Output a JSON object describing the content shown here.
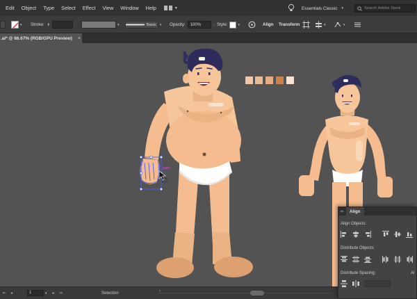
{
  "menu": {
    "items": [
      {
        "name": "menu-edit",
        "label": "Edit"
      },
      {
        "name": "menu-object",
        "label": "Object"
      },
      {
        "name": "menu-type",
        "label": "Type"
      },
      {
        "name": "menu-select",
        "label": "Select"
      },
      {
        "name": "menu-effect",
        "label": "Effect"
      },
      {
        "name": "menu-view",
        "label": "View"
      },
      {
        "name": "menu-window",
        "label": "Window"
      },
      {
        "name": "menu-help",
        "label": "Help"
      }
    ],
    "workspace": "Essentials Classic",
    "search_placeholder": "Search Adobe Stock"
  },
  "control": {
    "stroke_label": "Stroke:",
    "brush_label": "Basic",
    "opacity_label": "Opacity:",
    "opacity_value": "100%",
    "style_label": "Style:",
    "align_label": "Align",
    "transform_label": "Transform"
  },
  "document": {
    "tab_title": ".ai* @ 66.67% (RGB/GPU Preview)",
    "close_glyph": "×"
  },
  "canvas": {
    "path_label": "path",
    "swatches": [
      "#f2c9a8",
      "#ebbb94",
      "#e4ad85",
      "#c9844e",
      "#f7e3d0"
    ]
  },
  "status": {
    "artboard_value": "1",
    "tool_name": "Selection"
  },
  "align_panel": {
    "title": "Align",
    "align_objects": "Align Objects:",
    "distribute_objects": "Distribute Objects:",
    "distribute_spacing": "Distribute Spacing:",
    "align_to_short": "Al"
  },
  "colors": {
    "skin": "#f7c59a",
    "skin_shadow": "#e8ac7c",
    "skin_dark": "#d99a69",
    "hair": "#2e2c5c",
    "selection": "#4a5cf0",
    "brief": "#ffffff"
  }
}
